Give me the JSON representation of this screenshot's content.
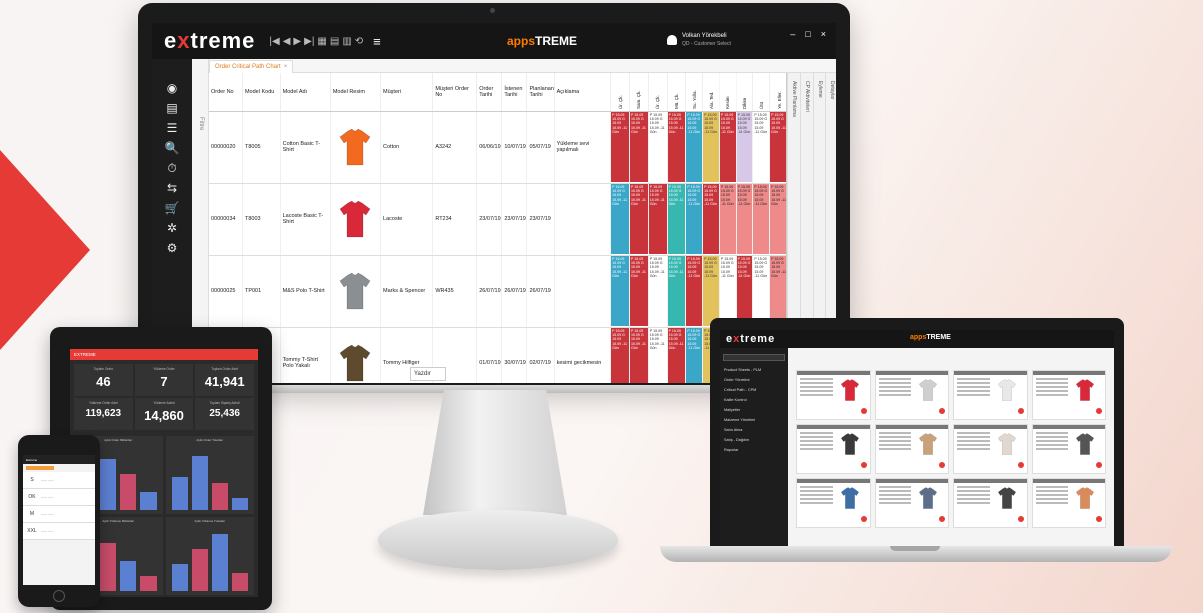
{
  "brand": {
    "logo_pre": "e",
    "logo_x": "x",
    "logo_post": "treme",
    "app_pre": "apps",
    "app_post": "TREME"
  },
  "colors": {
    "accent": "#e53a35",
    "app_orange": "#ff7a00"
  },
  "monitor": {
    "toolbar_icons": [
      "|◀",
      "◀",
      "▶",
      "▶|",
      "▦",
      "▤",
      "▥",
      "⟲"
    ],
    "menu_icon": "≡",
    "user": {
      "name": "Volkan Yörekbeli",
      "role": "QD - Customer Select"
    },
    "window_controls": [
      "–",
      "□",
      "×"
    ],
    "filter_label": "Filtre",
    "tab_label": "Order Critical Path Chart",
    "right_rails": [
      "Detaylar",
      "Eyleme",
      "CP Aktiviteleri",
      "Aktive Planlama"
    ],
    "rail_icons": [
      "◉",
      "▤",
      "☰",
      "🔍",
      "⏱",
      "⇆",
      "🛒",
      "✲",
      "⚙"
    ],
    "columns": [
      "Order No",
      "Model Kodu",
      "Model Adı",
      "Model Resim",
      "Müşteri",
      "Müşteri Order No",
      "Order Tarihi",
      "İstenen Tarihi",
      "Planlanan Tarihi",
      "Açıklama"
    ],
    "activity_columns": [
      "Ür. Çk.",
      "Sam. Çk.",
      "Ür. Çk.",
      "Mü. Çk.",
      "Su. Yolla.",
      "Ala. Ted.",
      "Kesim",
      "Dikim",
      "Ütü",
      "Ye. Eller."
    ],
    "rows": [
      {
        "order_no": "00000020",
        "model_code": "T8005",
        "model_name": "Cotton Basic T-Shirt",
        "customer": "Cotton",
        "customer_order": "A3242",
        "order_date": "06/06/19",
        "req_date": "10/07/19",
        "plan_date": "05/07/19",
        "note": "Yükleme sevi yapılmalı",
        "shirt_color": "#f26a1f"
      },
      {
        "order_no": "00000034",
        "model_code": "T8003",
        "model_name": "Lacoste Basic T-Shirt",
        "customer": "Lacoste",
        "customer_order": "RT234",
        "order_date": "23/07/19",
        "req_date": "23/07/19",
        "plan_date": "23/07/19",
        "note": "",
        "shirt_color": "#d9283a"
      },
      {
        "order_no": "00000025",
        "model_code": "TP001",
        "model_name": "M&S Polo T-Shirt",
        "customer": "Marks & Spencer",
        "customer_order": "WR435",
        "order_date": "26/07/19",
        "req_date": "26/07/19",
        "plan_date": "26/07/19",
        "note": "",
        "shirt_color": "#8a8f94"
      },
      {
        "order_no": "",
        "model_code": "",
        "model_name": "Tommy T-Shirt Polo Yakalı",
        "customer": "Tommy Hilfiger",
        "customer_order": "",
        "order_date": "01/07/19",
        "req_date": "30/07/19",
        "plan_date": "02/07/19",
        "note": "kesimi gecikmesin",
        "shirt_color": "#5e4b2e"
      }
    ],
    "cell_text": "P 15.09 15.09 G 15.09 15.09 -11 Gün",
    "print_label": "Yazdır"
  },
  "tablet": {
    "header": "EXTREME",
    "kpis": [
      {
        "label": "Toplam Order",
        "value": "46"
      },
      {
        "label": "Yükleme Order",
        "value": "7"
      },
      {
        "label": "Toplam Order Adet",
        "value": "41,941"
      },
      {
        "label": "Yükleme Order Adet",
        "value": "119,623"
      },
      {
        "label": "Yükleme Adedi",
        "value": "14,860"
      },
      {
        "label": "Toplam Sipariş Adedi",
        "value": "25,436"
      }
    ],
    "chart_titles": [
      "Aylık Order Miktarları",
      "Aylık Order Tutarları",
      "Aylık Yükleme Miktarları",
      "Aylık Yükleme Tutarları"
    ]
  },
  "phone": {
    "header": "Extreme",
    "sizes": [
      "S",
      "OK",
      "M",
      "XXL"
    ]
  },
  "laptop": {
    "menu": [
      "Product Sheets - PLM",
      "Order Yönetimi",
      "Critical Path - CPM",
      "Kalite Kontrol",
      "Maliyetler",
      "Malzeme Yönetimi",
      "Satın Alma",
      "Satış - Dağıtım",
      "Raporlar"
    ],
    "tab": "Ürün Listesi"
  }
}
